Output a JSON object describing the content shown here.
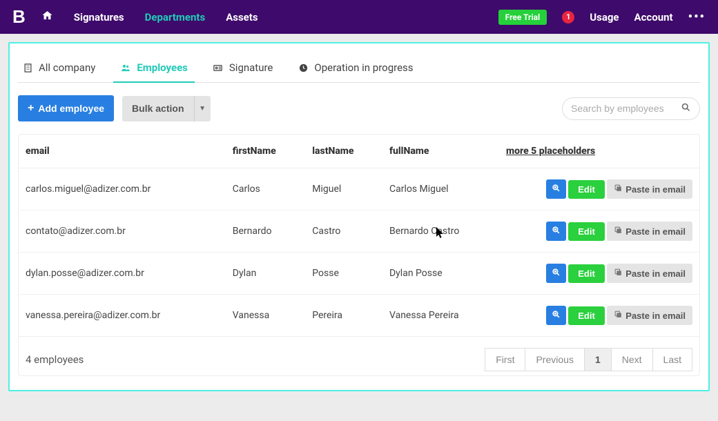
{
  "brand": "B",
  "nav": {
    "signatures": "Signatures",
    "departments": "Departments",
    "assets": "Assets",
    "free_trial": "Free Trial",
    "notifications": "1",
    "usage": "Usage",
    "account": "Account"
  },
  "tabs": {
    "all": "All company",
    "employees": "Employees",
    "signature": "Signature",
    "op": "Operation in progress"
  },
  "toolbar": {
    "add": "Add employee",
    "bulk": "Bulk action",
    "search_placeholder": "Search by employees"
  },
  "headers": {
    "email": "email",
    "firstName": "firstName",
    "lastName": "lastName",
    "fullName": "fullName",
    "more": "more 5 placeholders"
  },
  "rows": [
    {
      "email": "carlos.miguel@adizer.com.br",
      "firstName": "Carlos",
      "lastName": "Miguel",
      "fullName": "Carlos Miguel"
    },
    {
      "email": "contato@adizer.com.br",
      "firstName": "Bernardo",
      "lastName": "Castro",
      "fullName": "Bernardo Castro"
    },
    {
      "email": "dylan.posse@adizer.com.br",
      "firstName": "Dylan",
      "lastName": "Posse",
      "fullName": "Dylan Posse"
    },
    {
      "email": "vanessa.pereira@adizer.com.br",
      "firstName": "Vanessa",
      "lastName": "Pereira",
      "fullName": "Vanessa Pereira"
    }
  ],
  "actions": {
    "edit": "Edit",
    "paste": "Paste in email"
  },
  "footer": {
    "summary": "4 employees"
  },
  "pager": {
    "first": "First",
    "previous": "Previous",
    "page": "1",
    "next": "Next",
    "last": "Last"
  }
}
